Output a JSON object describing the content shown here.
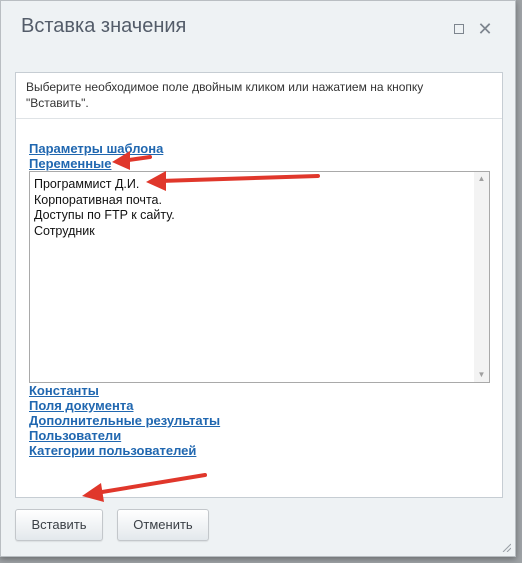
{
  "dialog": {
    "title": "Вставка значения",
    "hint": "Выберите необходимое поле двойным кликом или нажатием на кнопку \"Вставить\"."
  },
  "sections": [
    {
      "label": "Параметры шаблона"
    },
    {
      "label": "Переменные"
    },
    {
      "label": "Константы"
    },
    {
      "label": "Поля документа"
    },
    {
      "label": "Дополнительные результаты"
    },
    {
      "label": "Пользователи"
    },
    {
      "label": "Категории пользователей"
    }
  ],
  "variables": [
    "Программист Д.И.",
    "Корпоративная почта.",
    "Доступы по FTP к сайту.",
    "Сотрудник"
  ],
  "buttons": {
    "insert": "Вставить",
    "cancel": "Отменить"
  },
  "icons": {
    "maximize": "maximize-icon",
    "close": "close-icon"
  },
  "colors": {
    "link": "#2067b0",
    "annotation_arrow": "#e0372b"
  }
}
